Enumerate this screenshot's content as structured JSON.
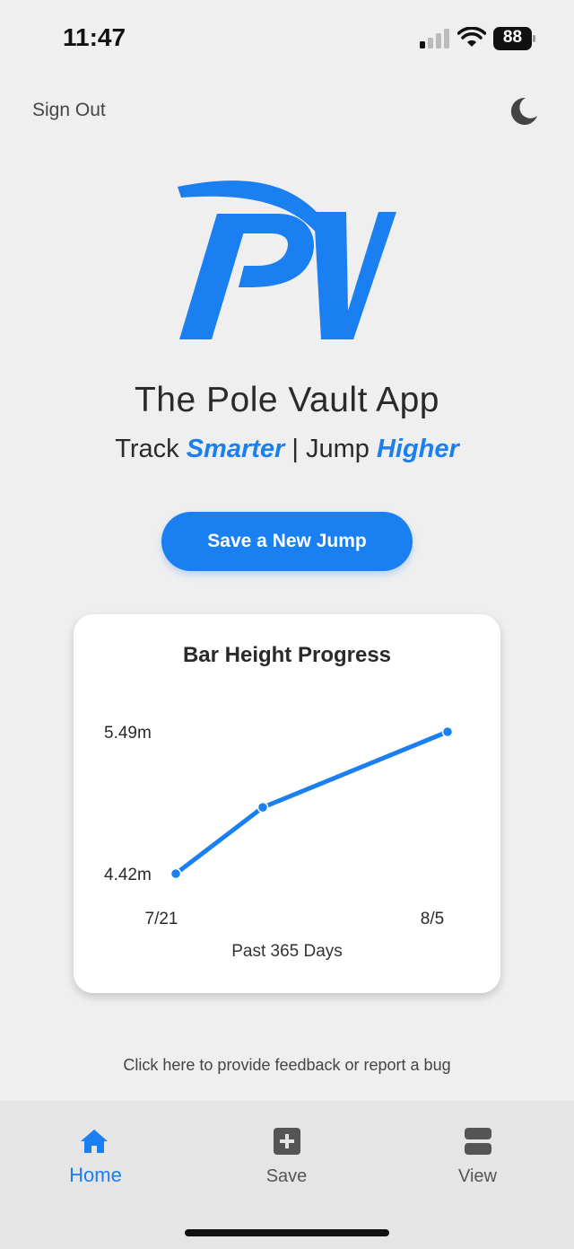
{
  "status_bar": {
    "time": "11:47",
    "battery": "88",
    "signal_icon": "cellular-signal-icon",
    "wifi_icon": "wifi-icon"
  },
  "header": {
    "sign_out_label": "Sign Out",
    "theme_icon": "moon-icon"
  },
  "logo": {
    "text": "PV",
    "color": "#1a7ff0"
  },
  "hero": {
    "title": "The Pole Vault App",
    "tagline_part1": "Track ",
    "tagline_accent1": "Smarter",
    "tagline_sep": " | Jump ",
    "tagline_accent2": "Higher"
  },
  "primary_action": {
    "label": "Save a New Jump"
  },
  "chart_card": {
    "caption": "Past 365 Days"
  },
  "chart_data": {
    "type": "line",
    "title": "Bar Height Progress",
    "x": [
      "7/21",
      "",
      "8/5"
    ],
    "x_tick_labels": [
      "7/21",
      "8/5"
    ],
    "series": [
      {
        "values": [
          4.42,
          4.92,
          5.49
        ]
      }
    ],
    "y_tick_labels": [
      "5.49m",
      "4.42m"
    ],
    "ylim": [
      4.42,
      5.49
    ],
    "line_color": "#1a7ff0",
    "grid": false,
    "legend": "none"
  },
  "feedback": {
    "label": "Click here to provide feedback or report a bug"
  },
  "tabs": [
    {
      "label": "Home",
      "icon": "home-icon",
      "active": true
    },
    {
      "label": "Save",
      "icon": "plus-square-icon",
      "active": false
    },
    {
      "label": "View",
      "icon": "stacked-rows-icon",
      "active": false
    }
  ],
  "colors": {
    "accent": "#1a7ff0",
    "background": "#efeff0",
    "tab_bar": "#e5e5e6"
  }
}
